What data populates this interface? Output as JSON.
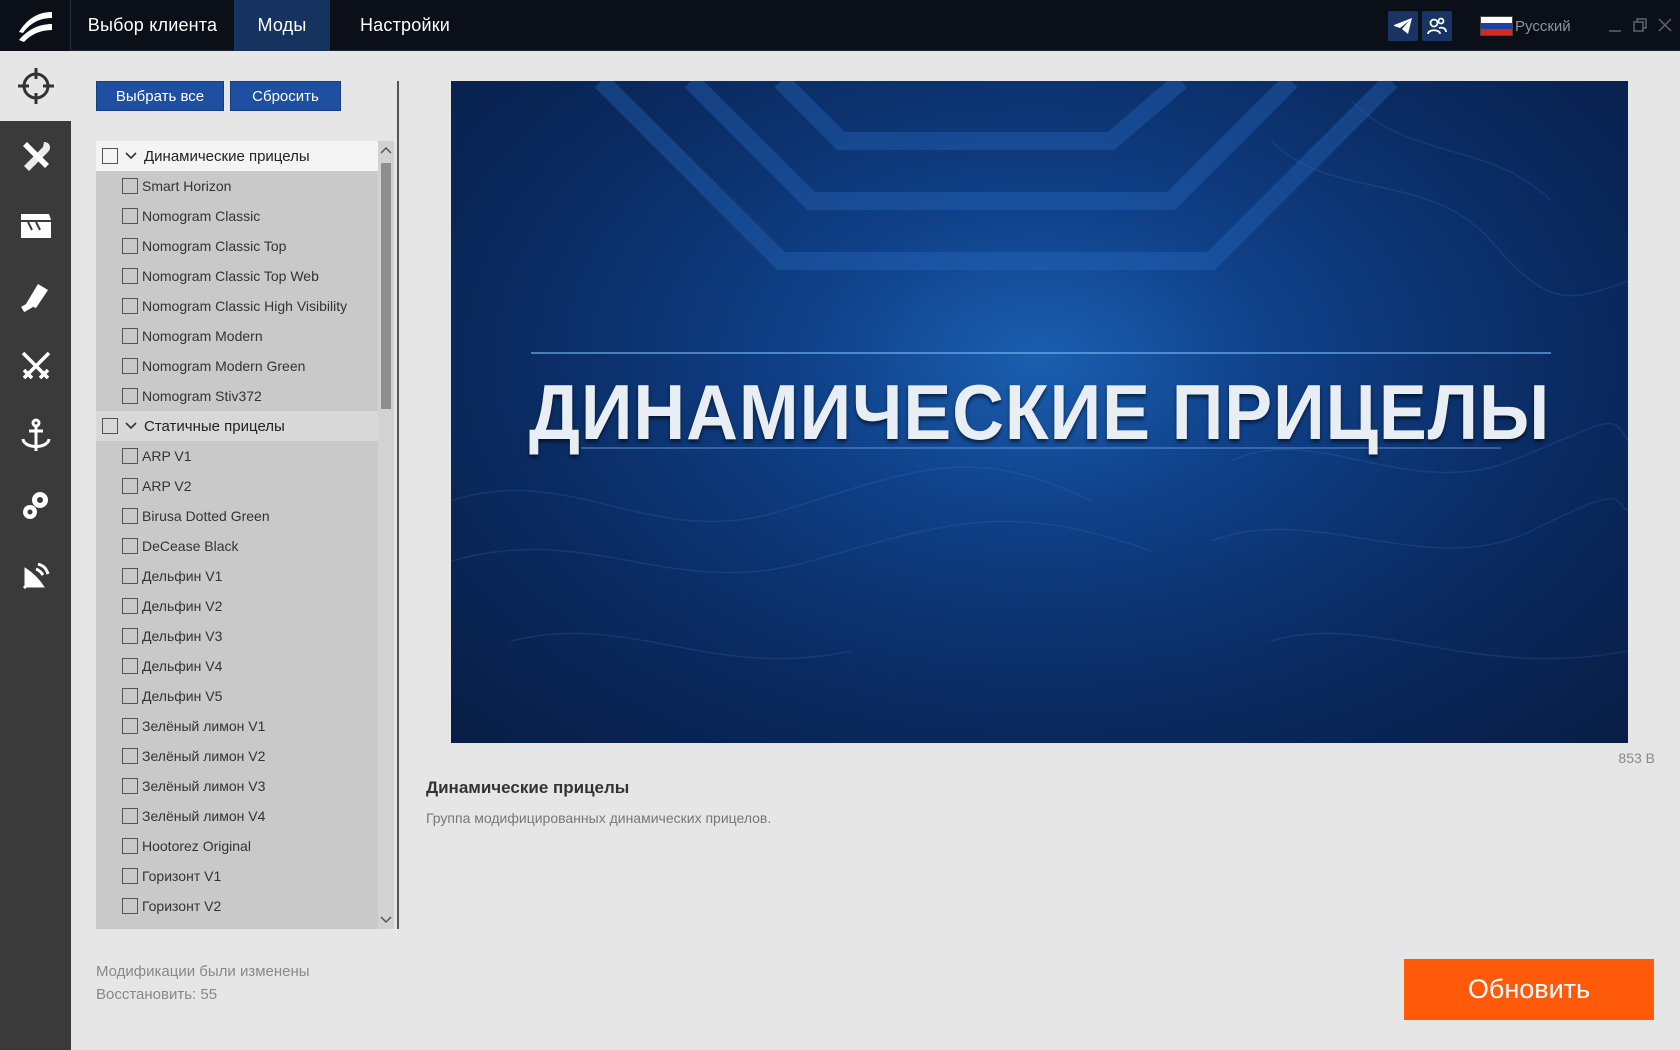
{
  "topbar": {
    "tabs": [
      {
        "label": "Выбор клиента"
      },
      {
        "label": "Моды"
      },
      {
        "label": "Настройки"
      }
    ],
    "language": "Русский"
  },
  "sidebar": {
    "icons": [
      "crosshair-icon",
      "wrench-tools-icon",
      "clapperboard-icon",
      "fist-icon",
      "swords-icon",
      "anchor-icon",
      "gears-icon",
      "satellite-icon"
    ]
  },
  "toolbar": {
    "select_all": "Выбрать все",
    "reset": "Сбросить"
  },
  "mod_list": {
    "groups": [
      {
        "label": "Динамические прицелы",
        "items": [
          "Smart Horizon",
          "Nomogram Classic",
          "Nomogram Classic Top",
          "Nomogram Classic Top Web",
          "Nomogram Classic High Visibility",
          "Nomogram Modern",
          "Nomogram Modern Green",
          "Nomogram Stiv372"
        ]
      },
      {
        "label": "Статичные прицелы",
        "items": [
          "ARP V1",
          "ARP V2",
          "Birusa Dotted Green",
          "DeCease Black",
          "Дельфин V1",
          "Дельфин V2",
          "Дельфин V3",
          "Дельфин V4",
          "Дельфин V5",
          "Зелёный лимон V1",
          "Зелёный лимон V2",
          "Зелёный лимон V3",
          "Зелёный лимон V4",
          "Hootorez Original",
          "Горизонт V1",
          "Горизонт V2"
        ]
      }
    ]
  },
  "preview": {
    "banner_title": "ДИНАМИЧЕСКИЕ ПРИЦЕЛЫ",
    "size": "853 B",
    "title": "Динамические прицелы",
    "description": "Группа модифицированных динамических прицелов."
  },
  "status": {
    "line1": "Модификации были изменены",
    "line2": "Восстановить: 55"
  },
  "actions": {
    "update": "Обновить"
  },
  "colors": {
    "accent_blue": "#1e4fa0",
    "active_tab": "#16325e",
    "update_orange": "#ff5a0a"
  }
}
